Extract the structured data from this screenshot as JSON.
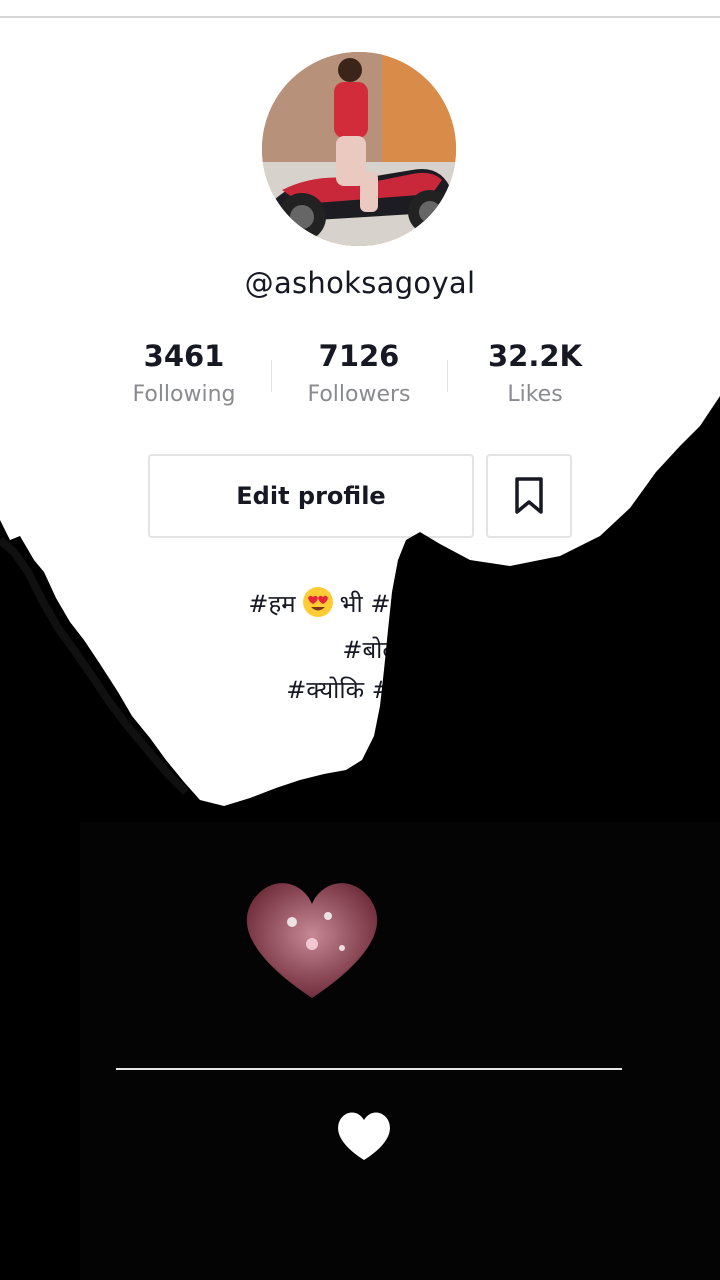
{
  "profile": {
    "username": "@ashoksagoyal"
  },
  "stats": [
    {
      "value": "3461",
      "label": "Following"
    },
    {
      "value": "7126",
      "label": "Followers"
    },
    {
      "value": "32.2K",
      "label": "Likes"
    }
  ],
  "actions": {
    "edit_profile": "Edit profile"
  },
  "bio": {
    "line1": {
      "a": "#हम",
      "b": "भी #_मोहब्बत"
    },
    "line2": "#बोलते_न",
    "line3": "#क्योकि #रिश्ते_"
  },
  "icons": {
    "favorites": "bookmark-icon",
    "sticker_top": "pink-hearts-icon",
    "sticker_bottom": "white-heart-icon",
    "emoji": "heart-eyes-emoji"
  }
}
